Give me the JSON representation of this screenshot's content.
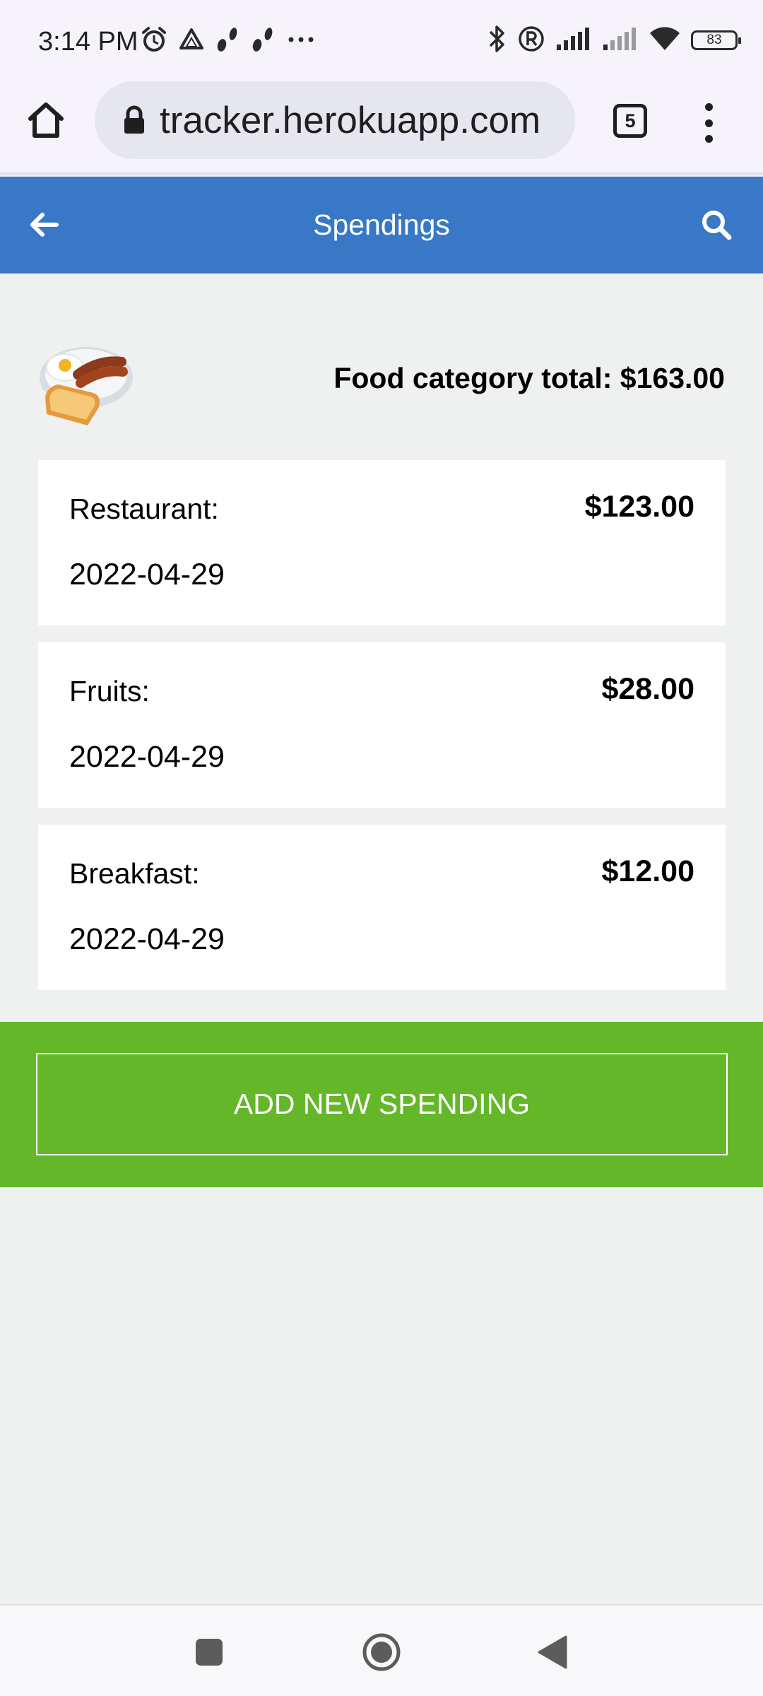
{
  "status_bar": {
    "time": "3:14 PM",
    "battery": "83",
    "left_icons": [
      "alarm-icon",
      "drive-icon",
      "footprints-icon",
      "footprints-icon",
      "more-dots-icon"
    ],
    "right_icons": [
      "bluetooth-icon",
      "registered-icon",
      "signal-icon",
      "signal-weak-icon",
      "wifi-icon",
      "battery-icon"
    ]
  },
  "browser": {
    "url": "tracker.herokuapp.com",
    "tab_count": "5"
  },
  "header": {
    "title": "Spendings"
  },
  "category": {
    "total_label": "Food category total: $163.00",
    "image": "breakfast-plate-image"
  },
  "spendings": [
    {
      "name": "Restaurant:",
      "amount": "$123.00",
      "date": "2022-04-29"
    },
    {
      "name": "Fruits:",
      "amount": "$28.00",
      "date": "2022-04-29"
    },
    {
      "name": "Breakfast:",
      "amount": "$12.00",
      "date": "2022-04-29"
    }
  ],
  "actions": {
    "add_label": "ADD NEW SPENDING"
  },
  "colors": {
    "header": "#3878c6",
    "add_panel": "#63b728",
    "background": "#eff0f0"
  }
}
